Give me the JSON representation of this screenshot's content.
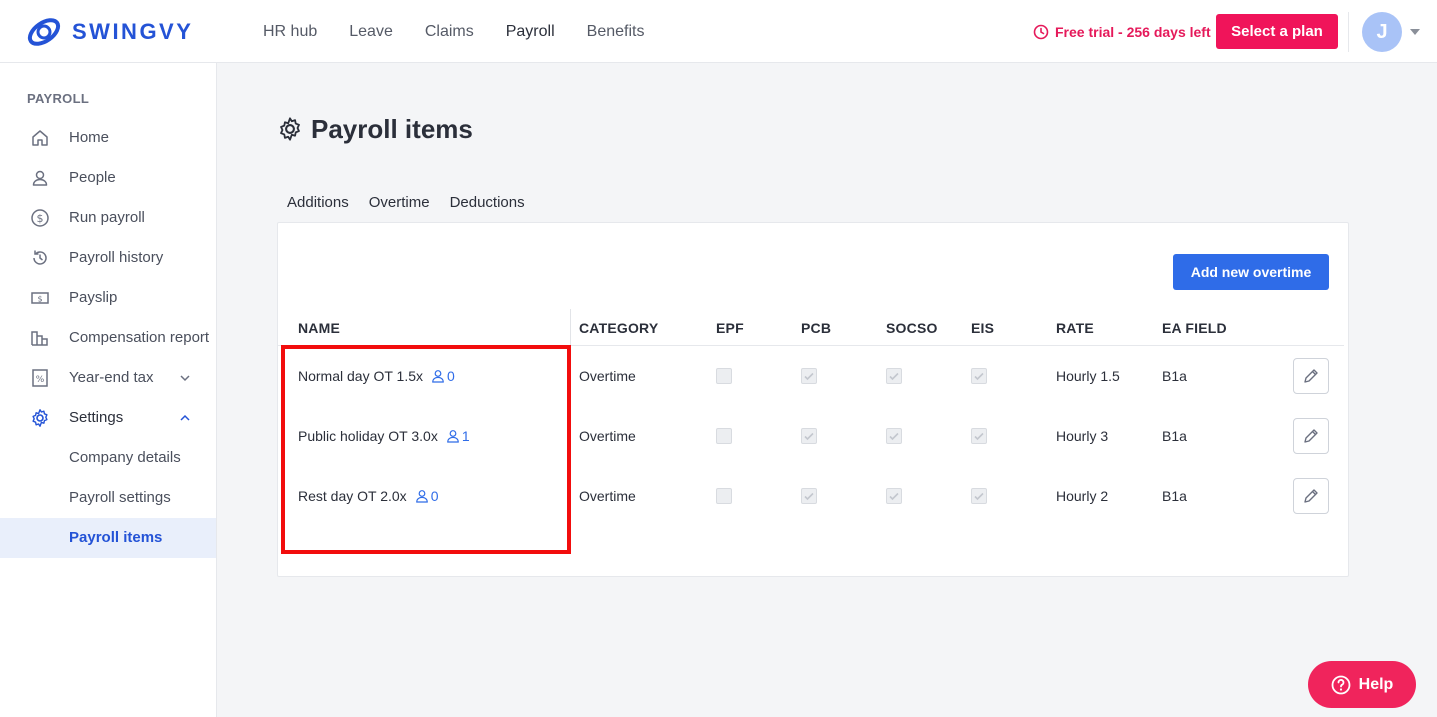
{
  "brand": {
    "name": "SWINGVY"
  },
  "topnav": {
    "items": [
      {
        "label": "HR hub",
        "active": false
      },
      {
        "label": "Leave",
        "active": false
      },
      {
        "label": "Claims",
        "active": false
      },
      {
        "label": "Payroll",
        "active": true
      },
      {
        "label": "Benefits",
        "active": false
      }
    ],
    "trial_text": "Free trial - 256 days left",
    "select_plan": "Select a plan",
    "avatar_initial": "J"
  },
  "sidebar": {
    "section": "PAYROLL",
    "items": [
      {
        "label": "Home",
        "icon": "home-icon"
      },
      {
        "label": "People",
        "icon": "person-icon"
      },
      {
        "label": "Run payroll",
        "icon": "dollar-cycle-icon"
      },
      {
        "label": "Payroll history",
        "icon": "history-icon"
      },
      {
        "label": "Payslip",
        "icon": "payslip-icon"
      },
      {
        "label": "Compensation report",
        "icon": "report-icon"
      },
      {
        "label": "Year-end tax",
        "icon": "percent-doc-icon"
      },
      {
        "label": "Settings",
        "icon": "gear-icon"
      },
      {
        "label": "Company details"
      },
      {
        "label": "Payroll settings"
      },
      {
        "label": "Payroll items"
      }
    ]
  },
  "page": {
    "title": "Payroll items",
    "tabs": [
      {
        "label": "Additions",
        "active": false
      },
      {
        "label": "Overtime",
        "active": true
      },
      {
        "label": "Deductions",
        "active": false
      }
    ],
    "add_button": "Add new overtime"
  },
  "table": {
    "headers": [
      "NAME",
      "CATEGORY",
      "EPF",
      "PCB",
      "SOCSO",
      "EIS",
      "RATE",
      "EA FIELD"
    ],
    "rows": [
      {
        "name": "Normal day OT 1.5x",
        "count": "0",
        "category": "Overtime",
        "epf": false,
        "pcb": true,
        "socso": true,
        "eis": true,
        "rate": "Hourly 1.5",
        "ea_field": "B1a"
      },
      {
        "name": "Public holiday OT 3.0x",
        "count": "1",
        "category": "Overtime",
        "epf": false,
        "pcb": true,
        "socso": true,
        "eis": true,
        "rate": "Hourly 3",
        "ea_field": "B1a"
      },
      {
        "name": "Rest day OT 2.0x",
        "count": "0",
        "category": "Overtime",
        "epf": false,
        "pcb": true,
        "socso": true,
        "eis": true,
        "rate": "Hourly 2",
        "ea_field": "B1a"
      }
    ]
  },
  "help": {
    "label": "Help"
  },
  "colors": {
    "brand_blue": "#2453d6",
    "accent_pink": "#f0145a",
    "button_blue": "#2f6ce8",
    "highlight_red": "#f20d0d"
  }
}
